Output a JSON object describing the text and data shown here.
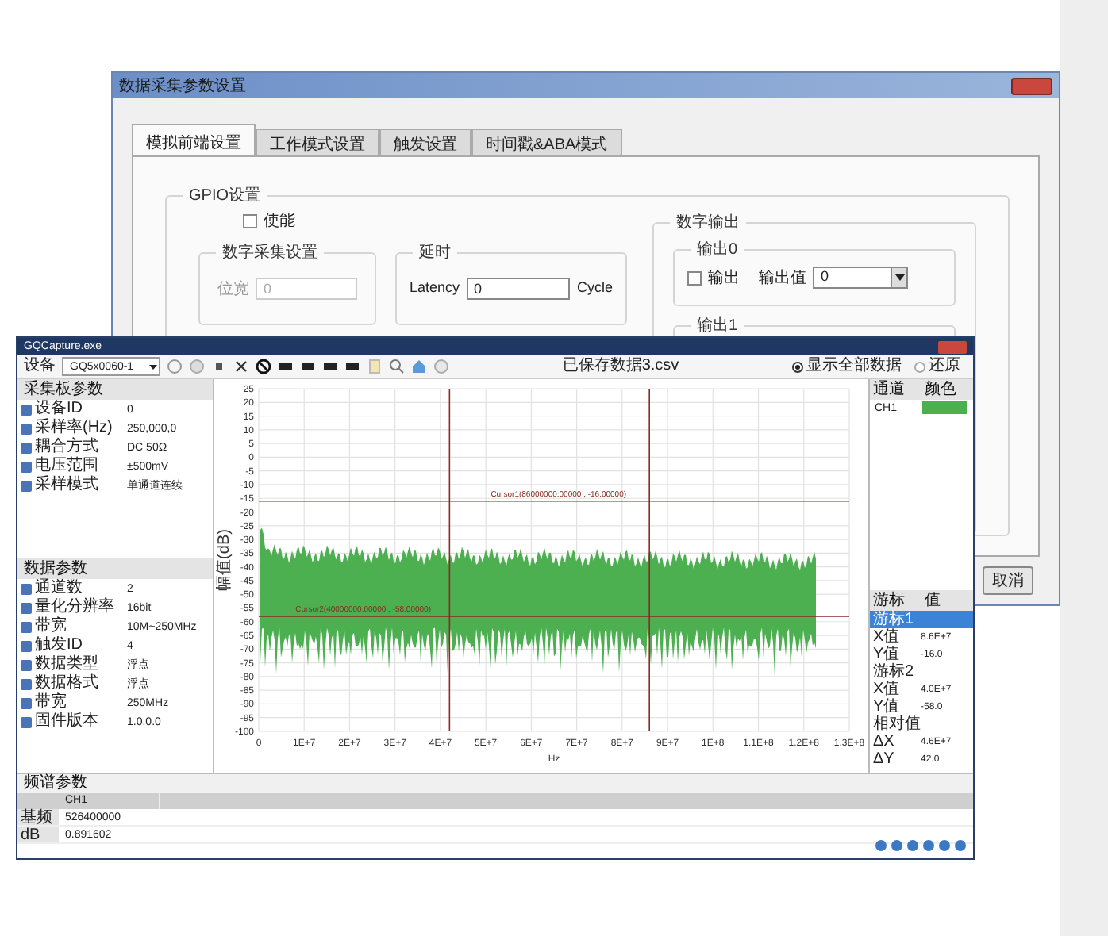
{
  "back_window": {
    "title": "数据采集参数设置",
    "tabs": [
      {
        "label": "模拟前端设置",
        "selected": true
      },
      {
        "label": "工作模式设置",
        "selected": false
      },
      {
        "label": "触发设置",
        "selected": false
      },
      {
        "label": "时间戳&ABA模式",
        "selected": false
      }
    ],
    "gpio": {
      "title": "GPIO设置",
      "enable": {
        "label": "使能",
        "checked": false
      },
      "digital_capture": {
        "title": "数字采集设置",
        "label": "位宽",
        "value": "0",
        "disabled": true
      },
      "delay": {
        "title": "延时",
        "label": "Latency",
        "value": "0",
        "unit": "Cycle"
      },
      "digital_output": {
        "title": "数字输出",
        "outputs": [
          {
            "title": "输出0",
            "checkbox": {
              "label": "输出",
              "checked": false
            },
            "value_label": "输出值",
            "value": "0"
          },
          {
            "title": "输出1"
          }
        ]
      }
    },
    "button": "取消"
  },
  "front_window": {
    "title": "GQCapture.exe",
    "toolbar": {
      "device_label": "设备",
      "device_value": "GQ5x0060-1",
      "file_name": "已保存数据3.csv",
      "radios": [
        {
          "label": "显示全部数据",
          "selected": true
        },
        {
          "label": "还原",
          "selected": false
        }
      ]
    },
    "board_params": {
      "title": "采集板参数",
      "rows": [
        {
          "label": "设备ID",
          "value": "0"
        },
        {
          "label": "采样率(Hz)",
          "value": "250,000,0"
        },
        {
          "label": "耦合方式",
          "value": "DC 50Ω"
        },
        {
          "label": "电压范围",
          "value": "±500mV"
        },
        {
          "label": "采样模式",
          "value": "单通道连续"
        }
      ]
    },
    "data_params": {
      "title": "数据参数",
      "rows": [
        {
          "label": "通道数",
          "value": "2"
        },
        {
          "label": "量化分辨率",
          "value": "16bit"
        },
        {
          "label": "带宽",
          "value": "10M~250MHz"
        },
        {
          "label": "触发ID",
          "value": "4"
        },
        {
          "label": "数据类型",
          "value": "浮点"
        },
        {
          "label": "数据格式",
          "value": "浮点"
        },
        {
          "label": "带宽",
          "value": "250MHz"
        },
        {
          "label": "固件版本",
          "value": "1.0.0.0"
        }
      ]
    },
    "plot": {
      "ylabel": "幅值(dB)",
      "xlabel": "Hz",
      "y_ticks": [
        "25",
        "20",
        "15",
        "10",
        "5",
        "0",
        "-5",
        "-10",
        "-15",
        "-20",
        "-25",
        "-30",
        "-35",
        "-40",
        "-45",
        "-50",
        "-55",
        "-60",
        "-65",
        "-70",
        "-75",
        "-80",
        "-85",
        "-90",
        "-95",
        "-100"
      ],
      "x_ticks": [
        "0",
        "1E+7",
        "2E+7",
        "3E+7",
        "4E+7",
        "5E+7",
        "6E+7",
        "7E+7",
        "8E+7",
        "9E+7",
        "1E+8",
        "1.1E+8",
        "1.2E+8",
        "1.3E+8"
      ],
      "cursors": [
        {
          "label": "Cursor1(86000000.00000 , -16.00000)"
        },
        {
          "label": "Cursor2(40000000.00000 , -58.00000)"
        }
      ]
    },
    "legend": {
      "columns": [
        "通道",
        "颜色"
      ],
      "rows": [
        {
          "name": "CH1",
          "color": "#4caf50"
        }
      ]
    },
    "cursor_table": {
      "columns": [
        "游标",
        "值"
      ],
      "rows": [
        {
          "label": "游标1",
          "selected": true
        },
        {
          "label": "X值",
          "value": "8.6E+7",
          "selected": false
        },
        {
          "label": "Y值",
          "value": "-16.0",
          "selected": false
        },
        {
          "label": "游标2",
          "selected": false
        },
        {
          "label": "X值",
          "value": "4.0E+7",
          "selected": false
        },
        {
          "label": "Y值",
          "value": "-58.0",
          "selected": false
        },
        {
          "label": "相对值",
          "selected": false
        },
        {
          "label": "ΔX",
          "value": "4.6E+7",
          "selected": false
        },
        {
          "label": "ΔY",
          "value": "42.0",
          "selected": false
        }
      ]
    },
    "spectrum_params": {
      "title": "频谱参数",
      "columns": [
        "CH1"
      ],
      "rows": [
        {
          "label": "基频",
          "values": [
            "526400000"
          ]
        },
        {
          "label": "dB",
          "values": [
            "0.891602"
          ]
        }
      ]
    }
  }
}
